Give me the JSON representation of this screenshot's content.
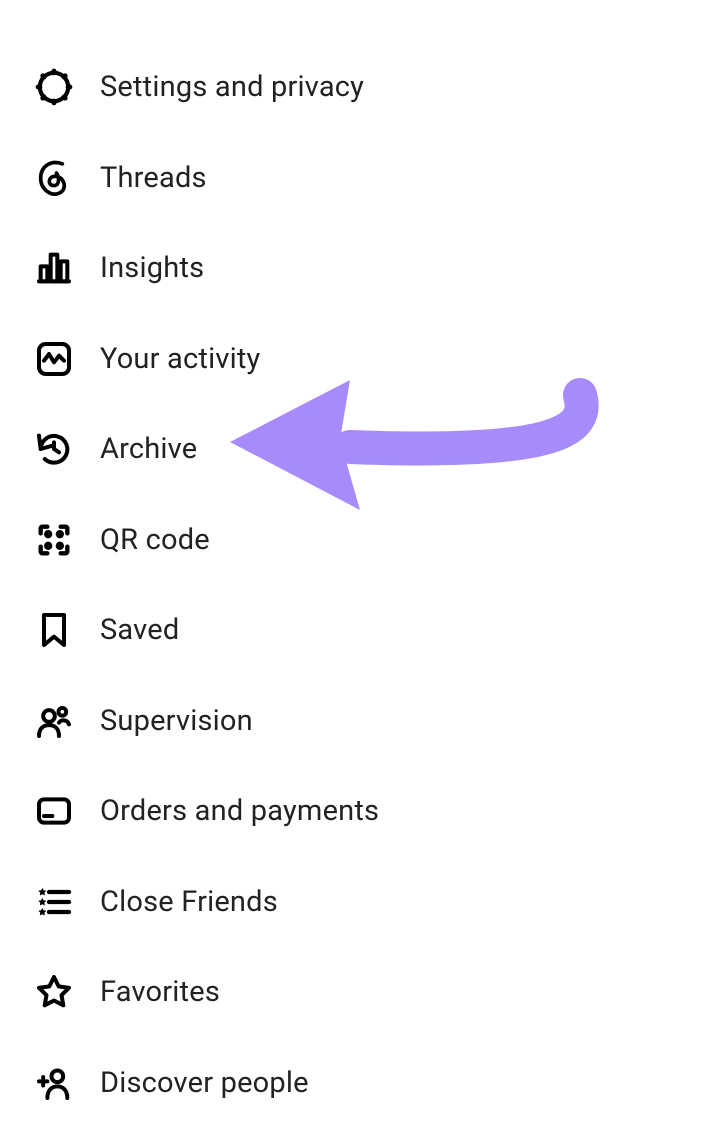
{
  "menu": {
    "items": [
      {
        "label": "Settings and privacy"
      },
      {
        "label": "Threads"
      },
      {
        "label": "Insights"
      },
      {
        "label": "Your activity"
      },
      {
        "label": "Archive"
      },
      {
        "label": "QR code"
      },
      {
        "label": "Saved"
      },
      {
        "label": "Supervision"
      },
      {
        "label": "Orders and payments"
      },
      {
        "label": "Close Friends"
      },
      {
        "label": "Favorites"
      },
      {
        "label": "Discover people"
      }
    ]
  },
  "annotation": {
    "target": "archive",
    "arrow_color": "#A78BFA"
  }
}
